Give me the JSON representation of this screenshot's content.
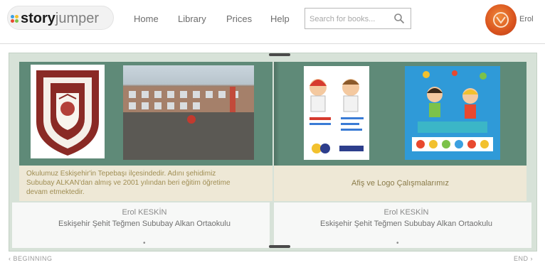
{
  "brand": {
    "logo_text_bold": "story",
    "logo_text_light": "jumper"
  },
  "nav": {
    "home": "Home",
    "library": "Library",
    "prices": "Prices",
    "help": "Help"
  },
  "search": {
    "placeholder": "Search for books..."
  },
  "user": {
    "name": "Erol"
  },
  "book": {
    "left_page": {
      "caption": "Okulumuz Eskişehir'in Tepebaşı ilçesindedir. Adını şehidimiz Sububay ALKAN'dan almış ve 2001 yılından beri eğitim öğretime devam etmektedir.",
      "author": "Erol KESKİN",
      "school": "Eskişehir Şehit Teğmen Sububay Alkan Ortaokulu"
    },
    "right_page": {
      "caption": "Afiş ve Logo Çalışmalarımız",
      "author": "Erol KESKİN",
      "school": "Eskişehir Şehit Teğmen Sububay Alkan Ortaokulu"
    }
  },
  "footer": {
    "beginning": "‹ BEGINNING",
    "end": "END ›"
  },
  "colors": {
    "accent_orange": "#d9531e",
    "page_green": "#5f8a78",
    "caption_bg": "#eee8d6"
  },
  "icons": [
    "search-icon",
    "user-avatar"
  ]
}
